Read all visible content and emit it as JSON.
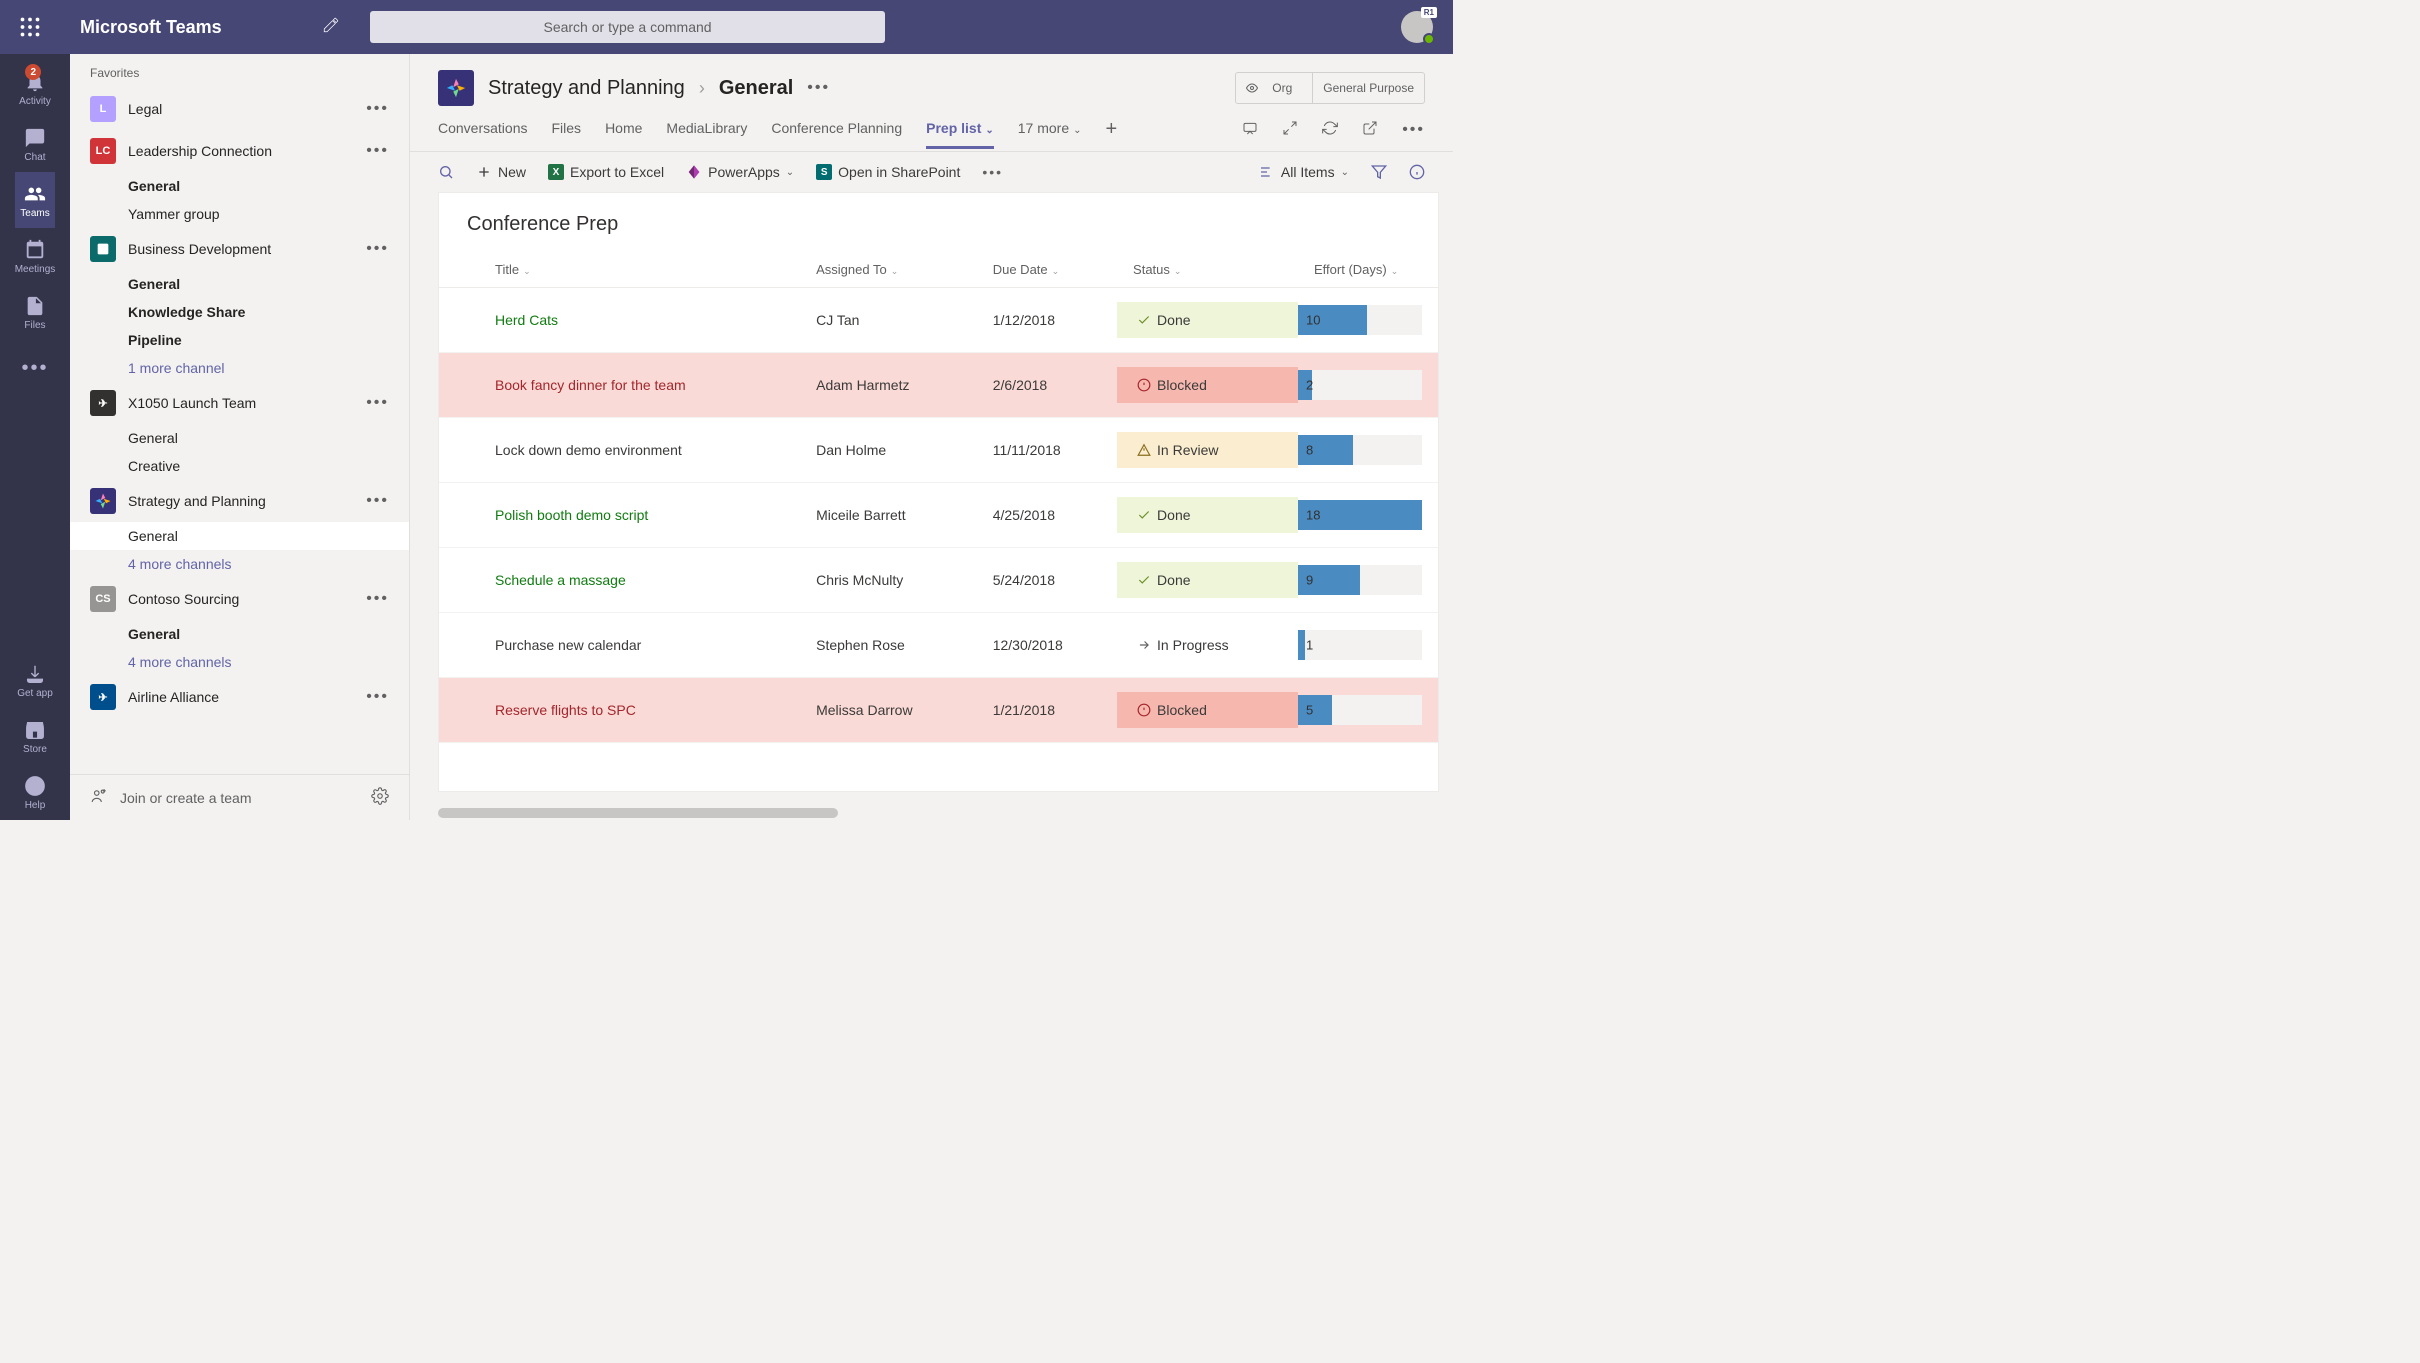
{
  "titlebar": {
    "app_name": "Microsoft Teams",
    "search_placeholder": "Search or type a command",
    "avatar_badge": "R1"
  },
  "apprail": {
    "items": [
      {
        "id": "activity",
        "label": "Activity",
        "badge": "2"
      },
      {
        "id": "chat",
        "label": "Chat"
      },
      {
        "id": "teams",
        "label": "Teams",
        "selected": true
      },
      {
        "id": "meetings",
        "label": "Meetings"
      },
      {
        "id": "files",
        "label": "Files"
      }
    ],
    "bottom": [
      {
        "id": "getapp",
        "label": "Get app"
      },
      {
        "id": "store",
        "label": "Store"
      },
      {
        "id": "help",
        "label": "Help"
      }
    ]
  },
  "sidebar": {
    "section": "Favorites",
    "teams": [
      {
        "name": "Legal",
        "color": "#b4a0ff",
        "initial": "L",
        "channels": []
      },
      {
        "name": "Leadership Connection",
        "color": "#d13438",
        "initial": "LC",
        "channels": [
          {
            "label": "General",
            "bold": true
          },
          {
            "label": "Yammer group"
          }
        ]
      },
      {
        "name": "Business Development",
        "color": "#0b6a6a",
        "initial": "",
        "channels": [
          {
            "label": "General",
            "bold": true
          },
          {
            "label": "Knowledge Share",
            "bold": true
          },
          {
            "label": "Pipeline",
            "bold": true
          },
          {
            "label": "1 more channel",
            "link": true
          }
        ]
      },
      {
        "name": "X1050 Launch Team",
        "color": "#323130",
        "initial": "✈",
        "channels": [
          {
            "label": "General"
          },
          {
            "label": "Creative"
          }
        ]
      },
      {
        "name": "Strategy and Planning",
        "color": "#373277",
        "initial": "",
        "channels": [
          {
            "label": "General",
            "selected": true
          },
          {
            "label": "4 more channels",
            "link": true
          }
        ]
      },
      {
        "name": "Contoso Sourcing",
        "color": "#979593",
        "initial": "CS",
        "channels": [
          {
            "label": "General",
            "bold": true
          },
          {
            "label": "4 more channels",
            "link": true
          }
        ]
      },
      {
        "name": "Airline Alliance",
        "color": "#004e8c",
        "initial": "✈",
        "channels": []
      }
    ],
    "footer": "Join or create a team"
  },
  "header": {
    "team": "Strategy and Planning",
    "channel": "General",
    "org_label": "Org",
    "purpose_label": "General Purpose"
  },
  "tabs": {
    "items": [
      "Conversations",
      "Files",
      "Home",
      "MediaLibrary",
      "Conference Planning"
    ],
    "active": "Prep list",
    "more": "17 more"
  },
  "toolbar": {
    "new": "New",
    "export": "Export to Excel",
    "powerapps": "PowerApps",
    "sharepoint": "Open in SharePoint",
    "view": "All Items"
  },
  "list": {
    "title": "Conference Prep",
    "columns": [
      "Title",
      "Assigned To",
      "Due Date",
      "Status",
      "Effort (Days)"
    ],
    "max_effort": 18,
    "rows": [
      {
        "title": "Herd Cats",
        "assigned": "CJ Tan",
        "due": "1/12/2018",
        "status": "Done",
        "effort": 10
      },
      {
        "title": "Book fancy dinner for the team",
        "assigned": "Adam Harmetz",
        "due": "2/6/2018",
        "status": "Blocked",
        "effort": 2
      },
      {
        "title": "Lock down demo environment",
        "assigned": "Dan Holme",
        "due": "11/11/2018",
        "status": "In Review",
        "effort": 8
      },
      {
        "title": "Polish booth demo script",
        "assigned": "Miceile Barrett",
        "due": "4/25/2018",
        "status": "Done",
        "effort": 18
      },
      {
        "title": "Schedule a massage",
        "assigned": "Chris McNulty",
        "due": "5/24/2018",
        "status": "Done",
        "effort": 9
      },
      {
        "title": "Purchase new calendar",
        "assigned": "Stephen Rose",
        "due": "12/30/2018",
        "status": "In Progress",
        "effort": 1
      },
      {
        "title": "Reserve flights to SPC",
        "assigned": "Melissa Darrow",
        "due": "1/21/2018",
        "status": "Blocked",
        "effort": 5
      }
    ]
  }
}
